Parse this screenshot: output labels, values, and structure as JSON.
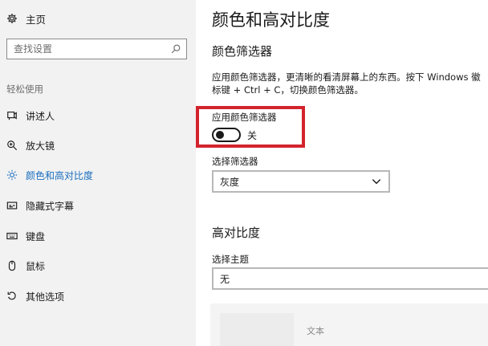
{
  "sidebar": {
    "home_label": "主页",
    "search": {
      "placeholder": "查找设置"
    },
    "section_label": "轻松使用",
    "items": [
      {
        "label": "讲述人",
        "icon": "narrator-icon"
      },
      {
        "label": "放大镜",
        "icon": "magnifier-icon"
      },
      {
        "label": "颜色和高对比度",
        "icon": "color-brightness-icon",
        "active": true
      },
      {
        "label": "隐藏式字幕",
        "icon": "closed-captions-icon"
      },
      {
        "label": "键盘",
        "icon": "keyboard-icon"
      },
      {
        "label": "鼠标",
        "icon": "mouse-icon"
      },
      {
        "label": "其他选项",
        "icon": "other-options-icon"
      }
    ]
  },
  "main": {
    "title": "颜色和高对比度",
    "color_filter": {
      "heading": "颜色筛选器",
      "description_line1": "应用颜色筛选器，更清晰的看清屏幕上的东西。按下 Windows 徽",
      "description_line2": "标键 + Ctrl + C，切换颜色筛选器。",
      "toggle_label": "应用颜色筛选器",
      "toggle_state": "关",
      "toggle_on": false,
      "select_label": "选择筛选器",
      "select_value": "灰度"
    },
    "high_contrast": {
      "heading": "高对比度",
      "theme_label": "选择主题",
      "theme_value": "无",
      "preview_text": "文本"
    }
  },
  "colors": {
    "accent": "#1a6fbf",
    "highlight_border": "#d3232d",
    "sidebar_bg": "#f2f2f2"
  }
}
